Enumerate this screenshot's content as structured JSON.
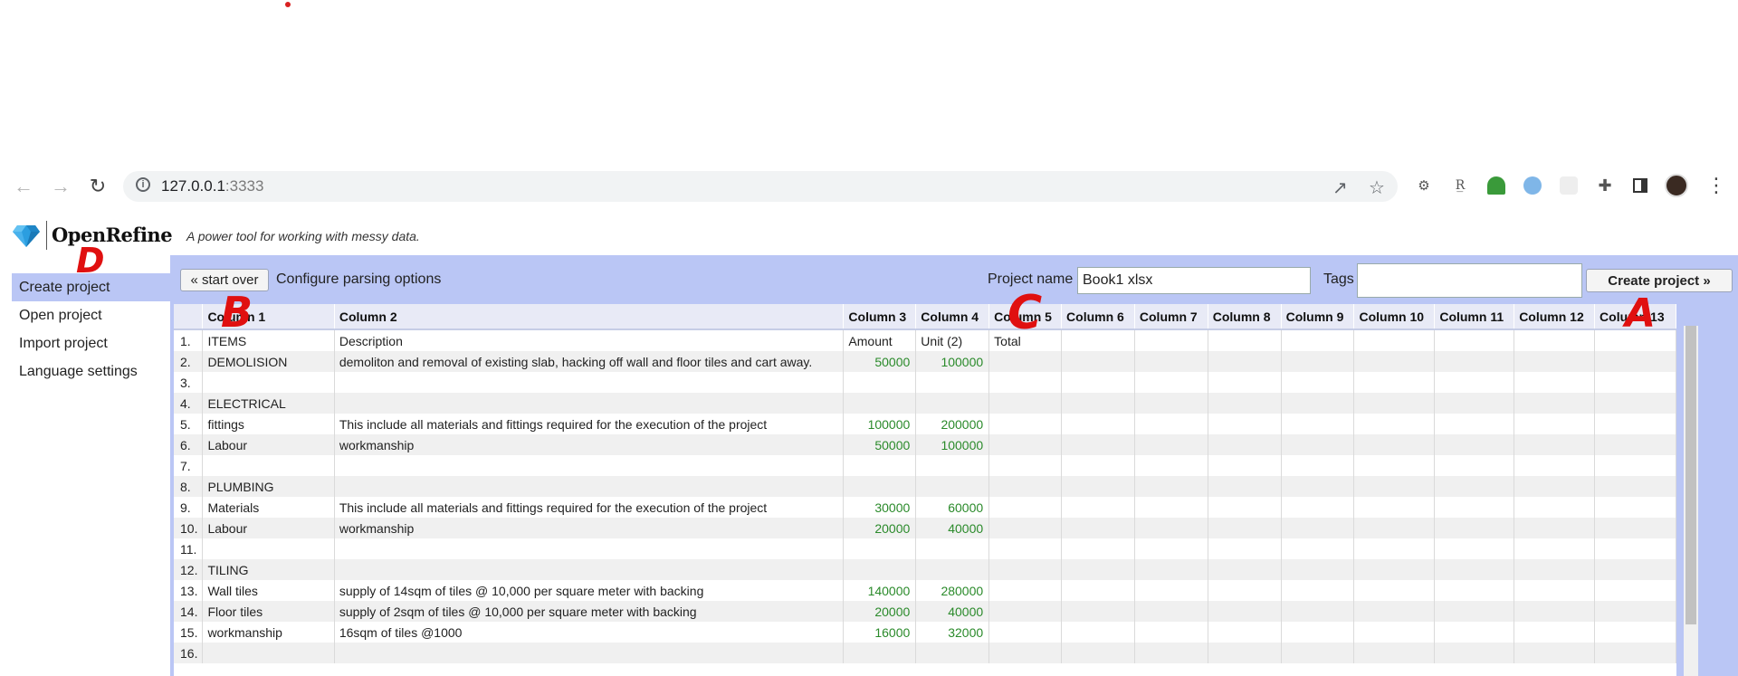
{
  "browser": {
    "url_host": "127.0.0.1",
    "url_port": ":3333"
  },
  "app": {
    "name": "OpenRefine",
    "tagline": "A power tool for working with messy data."
  },
  "sidebar": {
    "items": [
      {
        "label": "Create project",
        "active": true
      },
      {
        "label": "Open project",
        "active": false
      },
      {
        "label": "Import project",
        "active": false
      },
      {
        "label": "Language settings",
        "active": false
      }
    ]
  },
  "toolbar": {
    "start_over_label": "« start over",
    "configure_label": "Configure parsing options",
    "project_name_label": "Project name",
    "project_name_value": "Book1 xlsx",
    "tags_label": "Tags",
    "tags_value": "",
    "create_label": "Create project »"
  },
  "grid": {
    "columns": [
      "Column 1",
      "Column 2",
      "Column 3",
      "Column 4",
      "Column 5",
      "Column 6",
      "Column 7",
      "Column 8",
      "Column 9",
      "Column 10",
      "Column 11",
      "Column 12",
      "Column 13"
    ],
    "rows": [
      {
        "idx": "1.",
        "c1": "ITEMS",
        "c2": "Description",
        "c3": "Amount",
        "c4": "Unit (2)",
        "c5": "Total"
      },
      {
        "idx": "2.",
        "c1": "DEMOLISION",
        "c2": "demoliton and removal of existing slab, hacking off wall and floor tiles and cart away.",
        "c3": "50000",
        "c4": "100000",
        "c5": ""
      },
      {
        "idx": "3.",
        "c1": "",
        "c2": "",
        "c3": "",
        "c4": "",
        "c5": ""
      },
      {
        "idx": "4.",
        "c1": "ELECTRICAL",
        "c2": "",
        "c3": "",
        "c4": "",
        "c5": ""
      },
      {
        "idx": "5.",
        "c1": "fittings",
        "c2": "This include all materials and fittings required for the execution of the project",
        "c3": "100000",
        "c4": "200000",
        "c5": ""
      },
      {
        "idx": "6.",
        "c1": "Labour",
        "c2": "workmanship",
        "c3": "50000",
        "c4": "100000",
        "c5": ""
      },
      {
        "idx": "7.",
        "c1": "",
        "c2": "",
        "c3": "",
        "c4": "",
        "c5": ""
      },
      {
        "idx": "8.",
        "c1": "PLUMBING",
        "c2": "",
        "c3": "",
        "c4": "",
        "c5": ""
      },
      {
        "idx": "9.",
        "c1": "Materials",
        "c2": "This include all materials and fittings required for the execution of the project",
        "c3": "30000",
        "c4": "60000",
        "c5": ""
      },
      {
        "idx": "10.",
        "c1": "Labour",
        "c2": "workmanship",
        "c3": "20000",
        "c4": "40000",
        "c5": ""
      },
      {
        "idx": "11.",
        "c1": "",
        "c2": "",
        "c3": "",
        "c4": "",
        "c5": ""
      },
      {
        "idx": "12.",
        "c1": "TILING",
        "c2": "",
        "c3": "",
        "c4": "",
        "c5": ""
      },
      {
        "idx": "13.",
        "c1": "Wall tiles",
        "c2": "supply of 14sqm of tiles @ 10,000 per square meter with backing",
        "c3": "140000",
        "c4": "280000",
        "c5": ""
      },
      {
        "idx": "14.",
        "c1": "Floor tiles",
        "c2": "supply of 2sqm of tiles @ 10,000 per square meter with backing",
        "c3": "20000",
        "c4": "40000",
        "c5": ""
      },
      {
        "idx": "15.",
        "c1": "workmanship",
        "c2": "16sqm of tiles @1000",
        "c3": "16000",
        "c4": "32000",
        "c5": ""
      },
      {
        "idx": "16.",
        "c1": "",
        "c2": "",
        "c3": "",
        "c4": "",
        "c5": ""
      }
    ]
  },
  "annotations": [
    "A",
    "B",
    "C",
    "D"
  ],
  "colors": {
    "panel": "#bac6f5",
    "header_bg": "#e8eaf6",
    "number_text": "#2a8a2a",
    "annotation": "#e01010"
  }
}
